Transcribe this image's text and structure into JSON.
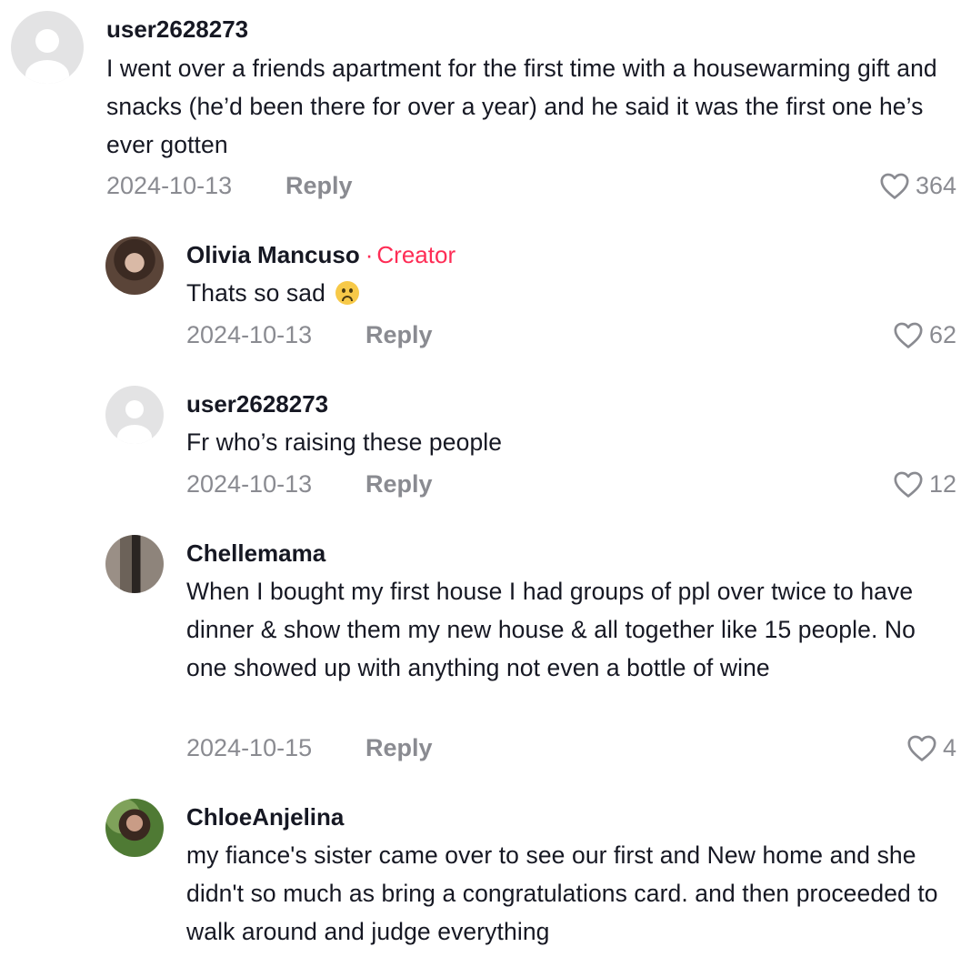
{
  "comments": [
    {
      "username": "user2628273",
      "text": "I went over a friends apartment for the first time with a housewarming gift and snacks (he’d been there for over a year) and he said it was the first one he’s ever gotten",
      "date": "2024-10-13",
      "reply_label": "Reply",
      "likes": "364",
      "avatar": "default-avatar"
    }
  ],
  "replies": [
    {
      "username": "Olivia Mancuso",
      "creator_dot": "·",
      "creator_label": "Creator",
      "text": "Thats so sad",
      "emoji": "frowning-face-emoji",
      "date": "2024-10-13",
      "reply_label": "Reply",
      "likes": "62",
      "avatar": "profile-photo"
    },
    {
      "username": "user2628273",
      "text": "Fr who’s raising these people",
      "date": "2024-10-13",
      "reply_label": "Reply",
      "likes": "12",
      "avatar": "default-avatar"
    },
    {
      "username": "Chellemama",
      "text": "When I bought my first house I had groups of ppl over twice to have dinner & show them my new house & all together like 15 people. No one showed up with anything not even a bottle of wine",
      "date": "2024-10-15",
      "reply_label": "Reply",
      "likes": "4",
      "avatar": "profile-photo"
    },
    {
      "username": "ChloeAnjelina",
      "text": "my fiance's sister came over to see our first and New home and she didn't so much as bring a congratulations card. and then proceeded to walk around and judge everything",
      "avatar": "profile-photo"
    }
  ],
  "icons": {
    "like": "heart-outline-icon"
  },
  "colors": {
    "text": "#161823",
    "muted": "#8a8b91",
    "creator": "#fe2c55",
    "background": "#ffffff"
  }
}
